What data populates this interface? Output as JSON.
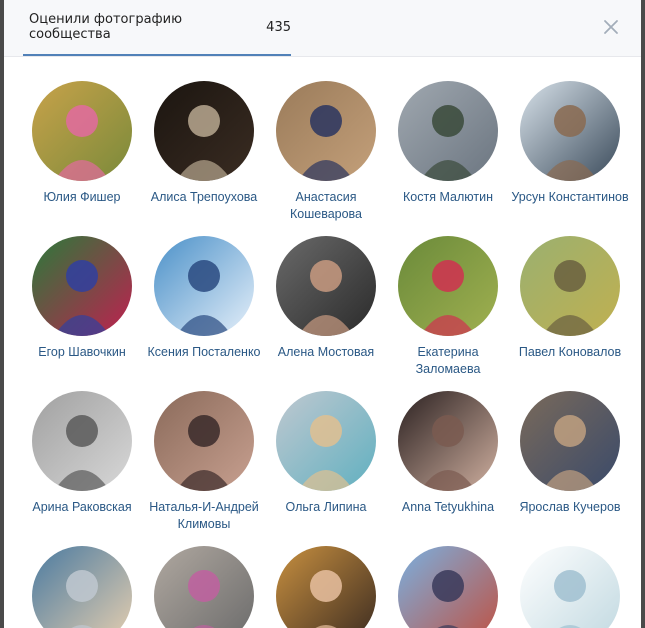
{
  "header": {
    "title": "Оценили фотографию сообщества",
    "count": "435"
  },
  "icons": {
    "close": "close-icon"
  },
  "people": [
    {
      "name": "Юлия Фишер",
      "colors": [
        "#c8a24a",
        "#7a8a3a",
        "#e36aa0"
      ]
    },
    {
      "name": "Алиса Трепоухова",
      "colors": [
        "#1b1510",
        "#3a2c22",
        "#b8a890"
      ]
    },
    {
      "name": "Анастасия Кошеварова",
      "colors": [
        "#9a7b5a",
        "#c4a07a",
        "#2a3560"
      ]
    },
    {
      "name": "Костя Малютин",
      "colors": [
        "#a0a8b0",
        "#6b7580",
        "#3a4a3a"
      ]
    },
    {
      "name": "Урсун Константинов",
      "colors": [
        "#d8e2ea",
        "#3a4a5a",
        "#8a6a50"
      ]
    },
    {
      "name": "Егор Шавочкин",
      "colors": [
        "#2a7a3a",
        "#c02050",
        "#3040a0"
      ]
    },
    {
      "name": "Ксения Посталенко",
      "colors": [
        "#4a90c8",
        "#e6f0fa",
        "#2a4a80"
      ]
    },
    {
      "name": "Алена Мостовая",
      "colors": [
        "#6a6a6a",
        "#2a2a2a",
        "#c89a80"
      ]
    },
    {
      "name": "Екатерина Заломаева",
      "colors": [
        "#6a8a3a",
        "#a0b050",
        "#d03050"
      ]
    },
    {
      "name": "Павел Коновалов",
      "colors": [
        "#9ab070",
        "#c0b050",
        "#6a6040"
      ]
    },
    {
      "name": "Арина Раковская",
      "colors": [
        "#a0a0a0",
        "#d8d8d8",
        "#5a5a5a"
      ]
    },
    {
      "name": "Наталья-И-Андрей Климовы",
      "colors": [
        "#8a6a5a",
        "#c8a090",
        "#3a2a2a"
      ]
    },
    {
      "name": "Ольга Липина",
      "colors": [
        "#c0c8d0",
        "#60b0c0",
        "#e0c090"
      ]
    },
    {
      "name": "Anna Tetyukhina",
      "colors": [
        "#2a2020",
        "#d0b0a0",
        "#7a5a50"
      ]
    },
    {
      "name": "Ярослав Кучеров",
      "colors": [
        "#7a6a5a",
        "#3a4a6a",
        "#c0a080"
      ]
    },
    {
      "name": "",
      "colors": [
        "#4a7aa0",
        "#e8d0b0",
        "#c0c8d0"
      ]
    },
    {
      "name": "",
      "colors": [
        "#b0a8a0",
        "#6a6a6a",
        "#c060a0"
      ]
    },
    {
      "name": "",
      "colors": [
        "#c89040",
        "#3a2a20",
        "#e8c0a0"
      ]
    },
    {
      "name": "",
      "colors": [
        "#7ab0e0",
        "#c05040",
        "#3a3a5a"
      ]
    },
    {
      "name": "",
      "colors": [
        "#ffffff",
        "#c0d8e0",
        "#a0c0d0"
      ]
    }
  ]
}
